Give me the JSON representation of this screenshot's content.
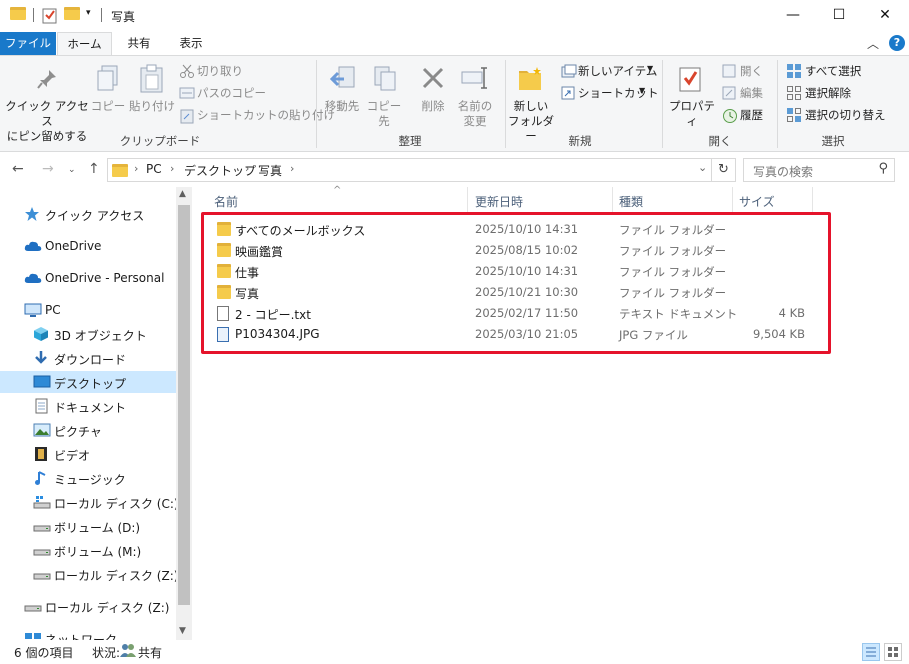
{
  "window": {
    "title": "写真",
    "minimize": "—",
    "maximize": "☐",
    "close": "✕"
  },
  "ribbon_tabs": [
    "ファイル",
    "ホーム",
    "共有",
    "表示"
  ],
  "ribbon": {
    "clipboard": {
      "pin_label_1": "クイック アクセス",
      "pin_label_2": "にピン留めする",
      "copy": "コピー",
      "paste": "貼り付け",
      "cut": "切り取り",
      "copy_path": "パスのコピー",
      "paste_shortcut": "ショートカットの貼り付け",
      "group": "クリップボード"
    },
    "organize": {
      "move_to": "移動先",
      "copy_to": "コピー先",
      "delete": "削除",
      "rename_1": "名前の",
      "rename_2": "変更",
      "group": "整理"
    },
    "new": {
      "new_folder_1": "新しい",
      "new_folder_2": "フォルダー",
      "new_item": "新しいアイテム",
      "shortcut": "ショートカット",
      "group": "新規"
    },
    "open": {
      "properties": "プロパティ",
      "open": "開く",
      "edit": "編集",
      "history": "履歴",
      "group": "開く"
    },
    "select": {
      "select_all": "すべて選択",
      "select_none": "選択解除",
      "invert": "選択の切り替え",
      "group": "選択"
    }
  },
  "address": {
    "crumbs": [
      "PC",
      "デスクトップ",
      "写真"
    ],
    "search_placeholder": "写真の検索"
  },
  "nav": [
    {
      "label": "クイック アクセス",
      "icon": "star-icon",
      "indent": 0
    },
    {
      "label": "OneDrive",
      "icon": "cloud-icon",
      "indent": 0
    },
    {
      "label": "OneDrive - Personal",
      "icon": "cloud-icon",
      "indent": 0
    },
    {
      "label": "PC",
      "icon": "pc-icon",
      "indent": 0
    },
    {
      "label": "3D オブジェクト",
      "icon": "cube-icon",
      "indent": 1
    },
    {
      "label": "ダウンロード",
      "icon": "download-icon",
      "indent": 1
    },
    {
      "label": "デスクトップ",
      "icon": "desktop-icon",
      "indent": 1,
      "selected": true
    },
    {
      "label": "ドキュメント",
      "icon": "document-icon",
      "indent": 1
    },
    {
      "label": "ピクチャ",
      "icon": "picture-icon",
      "indent": 1
    },
    {
      "label": "ビデオ",
      "icon": "video-icon",
      "indent": 1
    },
    {
      "label": "ミュージック",
      "icon": "music-icon",
      "indent": 1
    },
    {
      "label": "ローカル ディスク (C:)",
      "icon": "drive-c-icon",
      "indent": 1
    },
    {
      "label": "ボリューム (D:)",
      "icon": "drive-icon",
      "indent": 1
    },
    {
      "label": "ボリューム (M:)",
      "icon": "drive-icon",
      "indent": 1
    },
    {
      "label": "ローカル ディスク (Z:)",
      "icon": "drive-icon",
      "indent": 1
    },
    {
      "label": "ローカル ディスク (Z:)",
      "icon": "drive-icon",
      "indent": 0
    },
    {
      "label": "ネットワーク",
      "icon": "network-icon",
      "indent": 0
    }
  ],
  "columns": {
    "name": "名前",
    "date": "更新日時",
    "type": "種類",
    "size": "サイズ"
  },
  "files": [
    {
      "name": "すべてのメールボックス",
      "date": "2025/10/10 14:31",
      "type": "ファイル フォルダー",
      "size": "",
      "kind": "folder"
    },
    {
      "name": "映画鑑賞",
      "date": "2025/08/15 10:02",
      "type": "ファイル フォルダー",
      "size": "",
      "kind": "folder"
    },
    {
      "name": "仕事",
      "date": "2025/10/10 14:31",
      "type": "ファイル フォルダー",
      "size": "",
      "kind": "folder"
    },
    {
      "name": "写真",
      "date": "2025/10/21 10:30",
      "type": "ファイル フォルダー",
      "size": "",
      "kind": "folder"
    },
    {
      "name": "2 - コピー.txt",
      "date": "2025/02/17 11:50",
      "type": "テキスト ドキュメント",
      "size": "4 KB",
      "kind": "text"
    },
    {
      "name": "P1034304.JPG",
      "date": "2025/03/10 21:05",
      "type": "JPG ファイル",
      "size": "9,504 KB",
      "kind": "image"
    }
  ],
  "status": {
    "count": "6 個の項目",
    "state_label": "状況:",
    "state_value": "共有"
  },
  "colors": {
    "accent": "#1979ca",
    "highlight_border": "#e5132b",
    "selection": "#cce8ff"
  }
}
